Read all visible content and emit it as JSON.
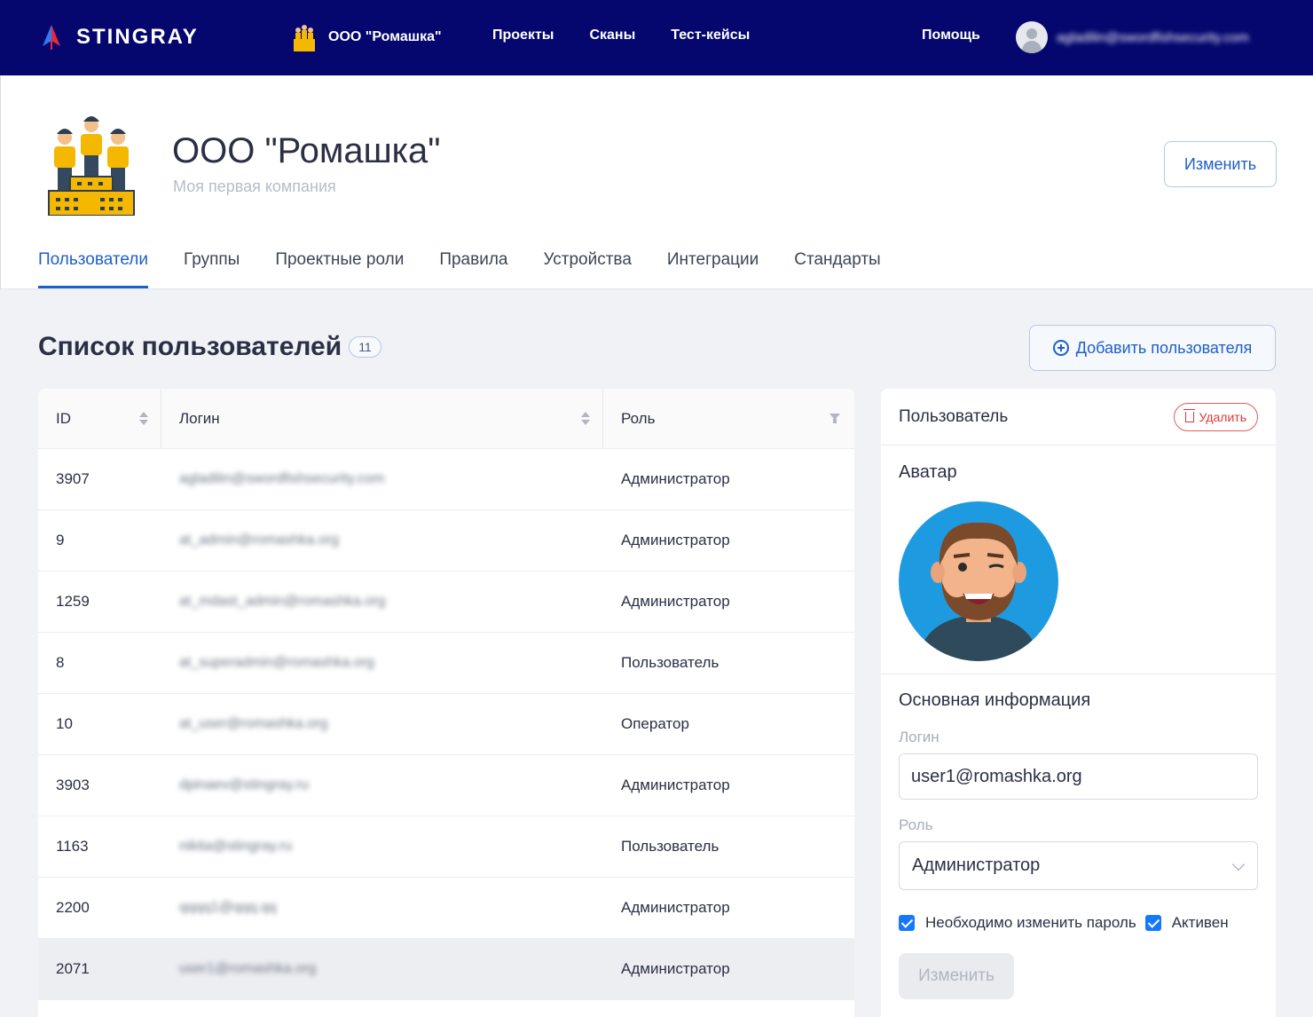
{
  "topbar": {
    "brand": "STINGRAY",
    "company": "ООО \"Ромашка\"",
    "nav": [
      "Проекты",
      "Сканы",
      "Тест-кейсы"
    ],
    "help": "Помощь",
    "user_email": "agladilin@swordfishsecurity.com",
    "colors": {
      "background": "#05066e",
      "logo_red": "#e8283c",
      "logo_blue": "#2d7bf2"
    }
  },
  "company": {
    "title": "ООО \"Ромашка\"",
    "subtitle": "Моя первая компания",
    "edit_label": "Изменить"
  },
  "tabs": [
    "Пользователи",
    "Группы",
    "Проектные роли",
    "Правила",
    "Устройства",
    "Интеграции",
    "Стандарты"
  ],
  "active_tab": "Пользователи",
  "users_list": {
    "title": "Список пользователей",
    "count": "11",
    "add_label": "Добавить пользователя",
    "columns": [
      "ID",
      "Логин",
      "Роль"
    ],
    "rows": [
      {
        "id": "3907",
        "login": "agladilin@swordfishsecurity.com",
        "role": "Администратор"
      },
      {
        "id": "9",
        "login": "at_admin@romashka.org",
        "role": "Администратор"
      },
      {
        "id": "1259",
        "login": "at_mdast_admin@romashka.org",
        "role": "Администратор"
      },
      {
        "id": "8",
        "login": "at_superadmin@romashka.org",
        "role": "Пользователь"
      },
      {
        "id": "10",
        "login": "at_user@romashka.org",
        "role": "Оператор"
      },
      {
        "id": "3903",
        "login": "dpinaev@stingray.ru",
        "role": "Администратор"
      },
      {
        "id": "1163",
        "login": "nikita@stingray.ru",
        "role": "Пользователь"
      },
      {
        "id": "2200",
        "login": "qqqq1@qqq.qq",
        "role": "Администратор"
      },
      {
        "id": "2071",
        "login": "user1@romashka.org",
        "role": "Администратор"
      }
    ],
    "selected_id": "2071"
  },
  "user_panel": {
    "title": "Пользователь",
    "delete_label": "Удалить",
    "avatar_label": "Аватар",
    "info_title": "Основная информация",
    "login_label": "Логин",
    "login_value": "user1@romashka.org",
    "role_label": "Роль",
    "role_value": "Администратор",
    "checkbox_password": "Необходимо изменить пароль",
    "checkbox_active": "Активен",
    "password_checked": true,
    "active_checked": true,
    "save_label": "Изменить"
  }
}
